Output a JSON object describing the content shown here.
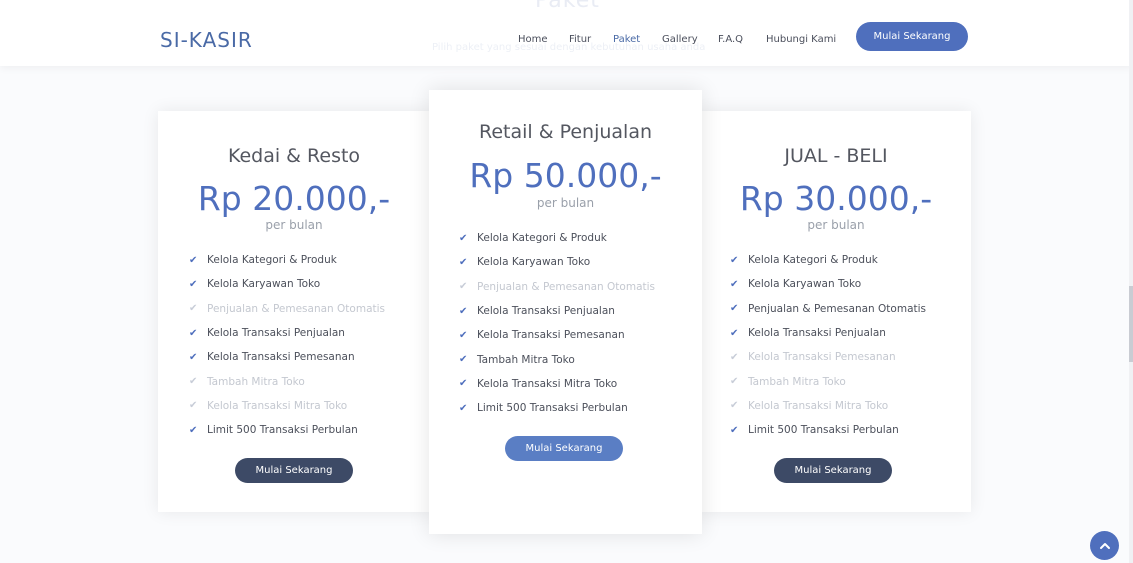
{
  "header": {
    "ghost_title": "Paket",
    "ghost_subtitle": "Pilih paket yang sesuai dengan kebutuhan usaha anda",
    "brand": "SI-KASIR",
    "nav": [
      "Home",
      "Fitur",
      "Paket",
      "Gallery",
      "F.A.Q",
      "Hubungi Kami"
    ],
    "active_nav": "Paket",
    "cta_label": "Mulai Sekarang"
  },
  "plans": [
    {
      "title": "Kedai & Resto",
      "price": "Rp 20.000,-",
      "period": "per bulan",
      "features": [
        {
          "label": "Kelola Kategori & Produk",
          "included": true
        },
        {
          "label": "Kelola Karyawan Toko",
          "included": true
        },
        {
          "label": "Penjualan & Pemesanan Otomatis",
          "included": false
        },
        {
          "label": "Kelola Transaksi Penjualan",
          "included": true
        },
        {
          "label": "Kelola Transaksi Pemesanan",
          "included": true
        },
        {
          "label": "Tambah Mitra Toko",
          "included": false
        },
        {
          "label": "Kelola Transaksi Mitra Toko",
          "included": false
        },
        {
          "label": "Limit 500 Transaksi Perbulan",
          "included": true
        }
      ],
      "button": "Mulai Sekarang"
    },
    {
      "title": "Retail & Penjualan",
      "price": "Rp 50.000,-",
      "period": "per bulan",
      "features": [
        {
          "label": "Kelola Kategori & Produk",
          "included": true
        },
        {
          "label": "Kelola Karyawan Toko",
          "included": true
        },
        {
          "label": "Penjualan & Pemesanan Otomatis",
          "included": false
        },
        {
          "label": "Kelola Transaksi Penjualan",
          "included": true
        },
        {
          "label": "Kelola Transaksi Pemesanan",
          "included": true
        },
        {
          "label": "Tambah Mitra Toko",
          "included": true
        },
        {
          "label": "Kelola Transaksi Mitra Toko",
          "included": true
        },
        {
          "label": "Limit 500 Transaksi Perbulan",
          "included": true
        }
      ],
      "button": "Mulai Sekarang"
    },
    {
      "title": "JUAL - BELI",
      "price": "Rp 30.000,-",
      "period": "per bulan",
      "features": [
        {
          "label": "Kelola Kategori & Produk",
          "included": true
        },
        {
          "label": "Kelola Karyawan Toko",
          "included": true
        },
        {
          "label": "Penjualan & Pemesanan Otomatis",
          "included": true
        },
        {
          "label": "Kelola Transaksi Penjualan",
          "included": true
        },
        {
          "label": "Kelola Transaksi Pemesanan",
          "included": false
        },
        {
          "label": "Tambah Mitra Toko",
          "included": false
        },
        {
          "label": "Kelola Transaksi Mitra Toko",
          "included": false
        },
        {
          "label": "Limit 500 Transaksi Perbulan",
          "included": true
        }
      ],
      "button": "Mulai Sekarang"
    }
  ],
  "icons": {
    "check": "check-icon",
    "back_to_top": "chevron-up-icon"
  },
  "colors": {
    "brand": "#4f6fbd",
    "dark_button": "#3d4a66",
    "muted_text": "#c4c8d0"
  }
}
